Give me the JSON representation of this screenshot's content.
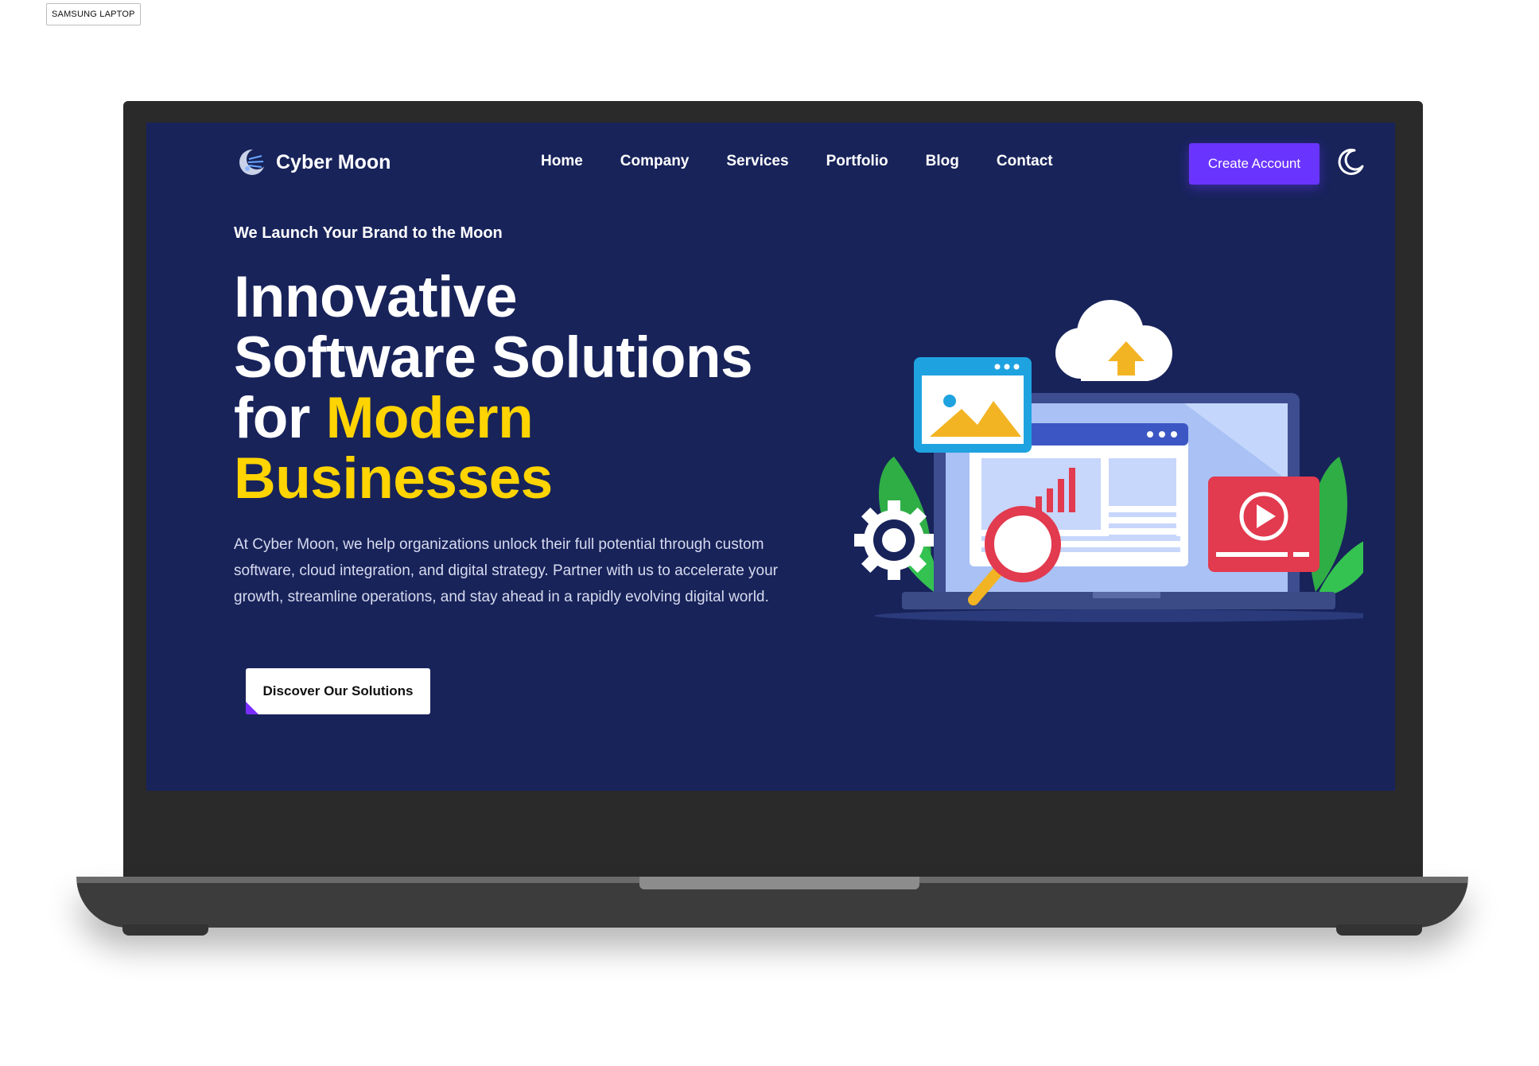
{
  "device_label": "SAMSUNG LAPTOP",
  "site": {
    "brand": "Cyber Moon",
    "nav": [
      "Home",
      "Company",
      "Services",
      "Portfolio",
      "Blog",
      "Contact"
    ],
    "cta_label": "Create Account",
    "theme_toggle_icon": "moon-icon"
  },
  "hero": {
    "eyebrow": "We Launch Your Brand to the Moon",
    "headline_line1": "Innovative",
    "headline_line2": "Software Solutions",
    "headline_line3_prefix": "for ",
    "headline_line3_highlight": "Modern",
    "headline_line4": "Businesses",
    "description": "At Cyber Moon, we help organizations unlock their full potential through custom software, cloud integration, and digital strategy. Partner with us to accelerate your growth, streamline operations, and stay ahead in a rapidly evolving digital world.",
    "button_label": "Discover Our Solutions"
  },
  "colors": {
    "page_bg": "#18235a",
    "accent": "#6a34ff",
    "highlight": "#ffd400"
  },
  "illustration_icons": [
    "cloud-upload-icon",
    "image-icon",
    "laptop-icon",
    "bar-chart-icon",
    "gear-icon",
    "magnifier-icon",
    "video-play-icon",
    "leaf-icon"
  ]
}
